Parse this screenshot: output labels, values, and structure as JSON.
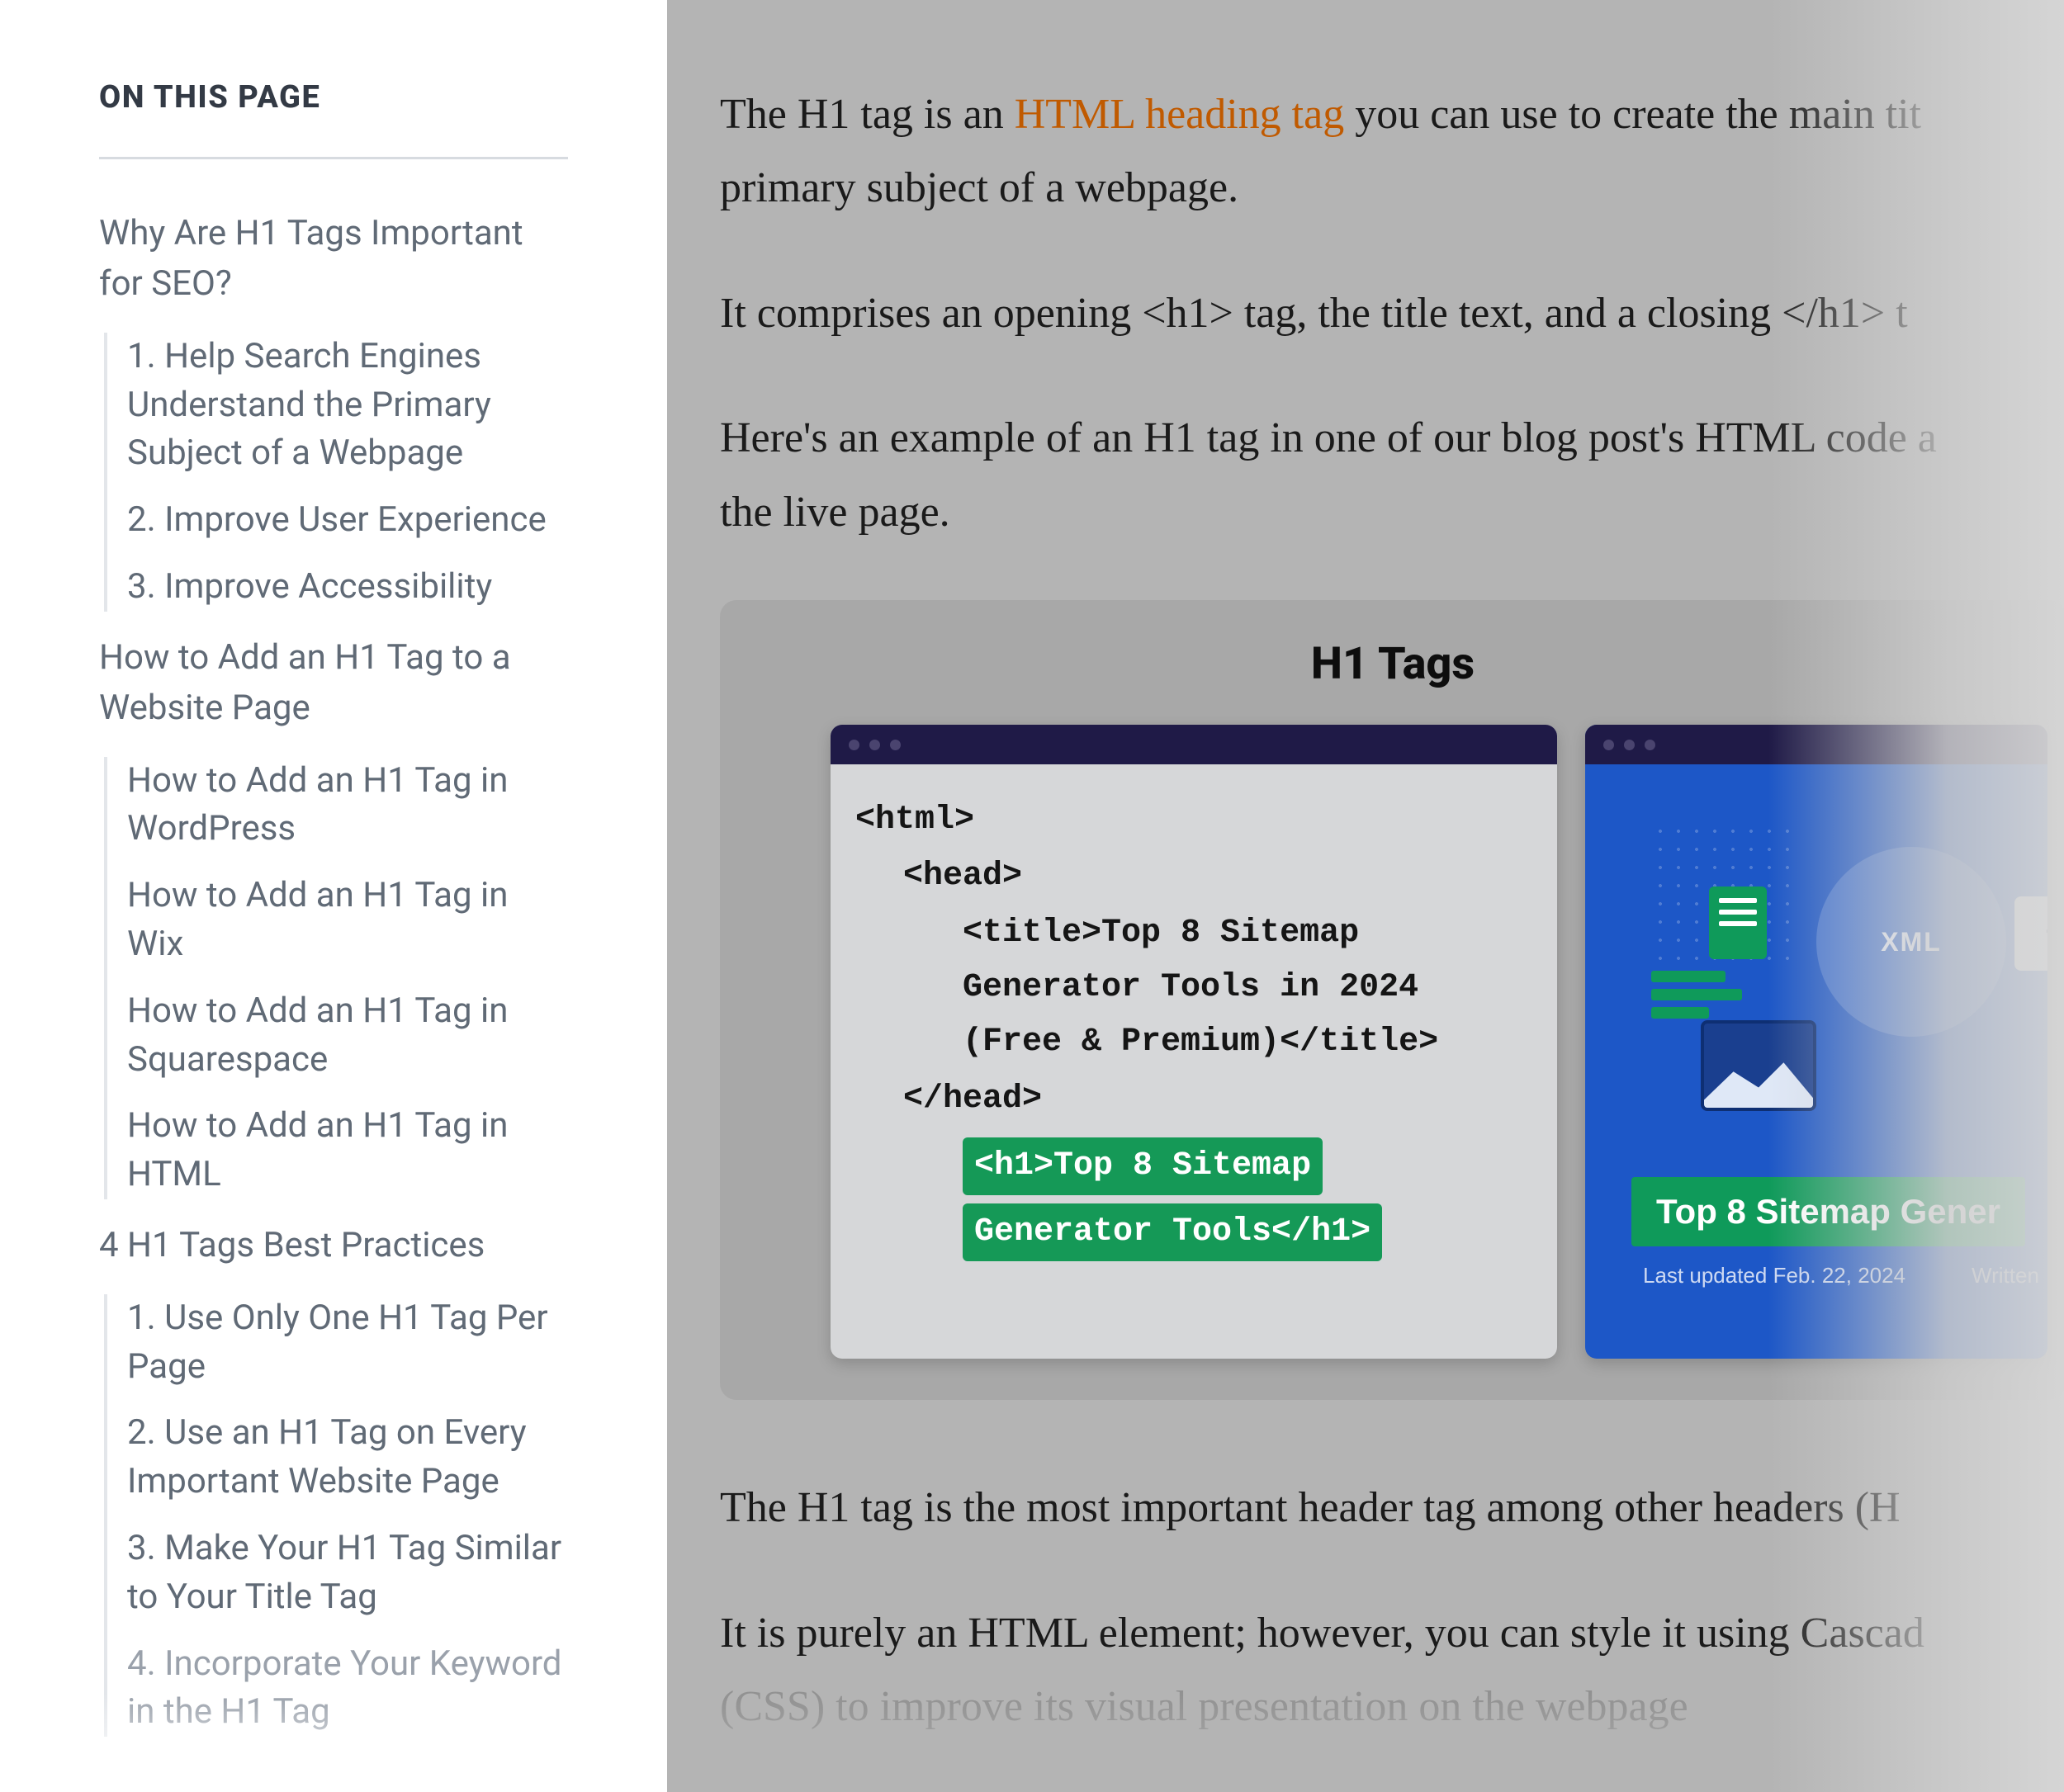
{
  "sidebar": {
    "title": "ON THIS PAGE",
    "sections": [
      {
        "label": "Why Are H1 Tags Important for SEO?",
        "children": [
          "1. Help Search Engines Understand the Primary Subject of a Webpage",
          "2. Improve User Experience",
          "3. Improve Accessibility"
        ]
      },
      {
        "label": "How to Add an H1 Tag to a Website Page",
        "children": [
          "How to Add an H1 Tag in WordPress",
          "How to Add an H1 Tag in Wix",
          "How to Add an H1 Tag in Squarespace",
          "How to Add an H1 Tag in HTML"
        ]
      },
      {
        "label": "4 H1 Tags Best Practices",
        "children": [
          "1. Use Only One H1 Tag Per Page",
          "2. Use an H1 Tag on Every Important Website Page",
          "3. Make Your H1 Tag Similar to Your Title Tag",
          "4. Incorporate Your Keyword in the H1 Tag"
        ]
      }
    ]
  },
  "article": {
    "p1_a": "The H1 tag is an ",
    "p1_link": "HTML heading tag",
    "p1_b": " you can use to create the main tit",
    "p1_line2": "primary subject of a webpage.",
    "p2": "It comprises an opening <h1> tag, the title text, and a closing </h1> t",
    "p3_a": "Here's an example of an H1 tag in one of our blog post's HTML code a",
    "p3_b": "the live page.",
    "p4": "The H1 tag is the most important header tag among other headers (H",
    "p5_a": "It is purely an HTML element; however, you can style it using Cascad",
    "p5_b": "(CSS) to improve its visual presentation on the webpage"
  },
  "figure": {
    "title": "H1 Tags",
    "code": {
      "l1": "<html>",
      "l2": "<head>",
      "l3": "<title>Top 8 Sitemap Generator Tools in 2024 (Free & Premium)</title>",
      "l4": "</head>",
      "h1a": "<h1>Top 8 Sitemap",
      "h1b": "Generator Tools</h1>"
    },
    "live": {
      "xml_label": "XML",
      "code_chip": "</",
      "title": "Top 8 Sitemap Gener",
      "meta_updated": "Last updated Feb. 22, 2024",
      "meta_written": "Written"
    }
  }
}
